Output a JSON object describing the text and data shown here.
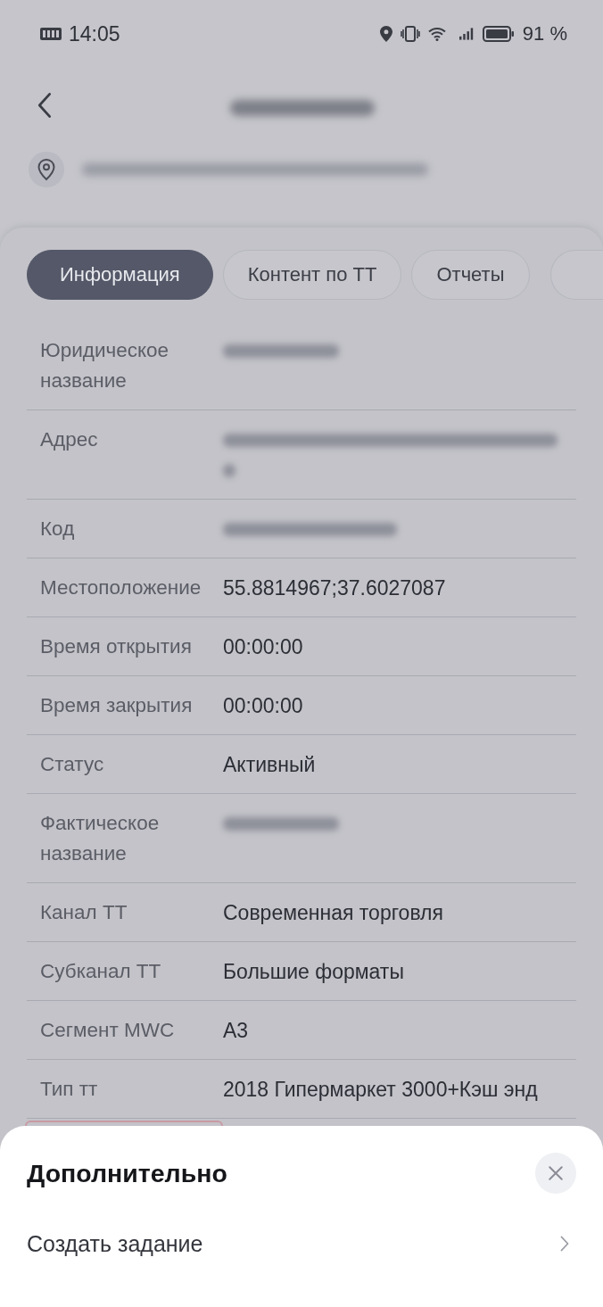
{
  "status_bar": {
    "time": "14:05",
    "battery": "91 %"
  },
  "tabs": [
    {
      "label": "Информация",
      "selected": true
    },
    {
      "label": "Контент по ТТ",
      "selected": false
    },
    {
      "label": "Отчеты",
      "selected": false
    }
  ],
  "details": [
    {
      "label": "Юридическое название",
      "kind": "blurred_name"
    },
    {
      "label": "Адрес",
      "kind": "blurred_address"
    },
    {
      "label": "Код",
      "kind": "blurred_code"
    },
    {
      "label": "Местоположение",
      "kind": "text",
      "value": "55.8814967;37.6027087"
    },
    {
      "label": "Время открытия",
      "kind": "text",
      "value": "00:00:00"
    },
    {
      "label": "Время закрытия",
      "kind": "text",
      "value": "00:00:00"
    },
    {
      "label": "Статус",
      "kind": "text",
      "value": "Активный"
    },
    {
      "label": "Фактическое название",
      "kind": "blurred_name"
    },
    {
      "label": "Канал ТТ",
      "kind": "text",
      "value": "Современная торговля"
    },
    {
      "label": "Субканал ТТ",
      "kind": "text",
      "value": "Большие форматы"
    },
    {
      "label": "Сегмент MWC",
      "kind": "text",
      "value": "A3"
    },
    {
      "label": "Тип тт",
      "kind": "text",
      "value": "2018 Гипермаркет 3000+Кэш энд"
    }
  ],
  "sheet": {
    "title": "Дополнительно",
    "items": [
      {
        "label": "Создать задание"
      }
    ]
  }
}
